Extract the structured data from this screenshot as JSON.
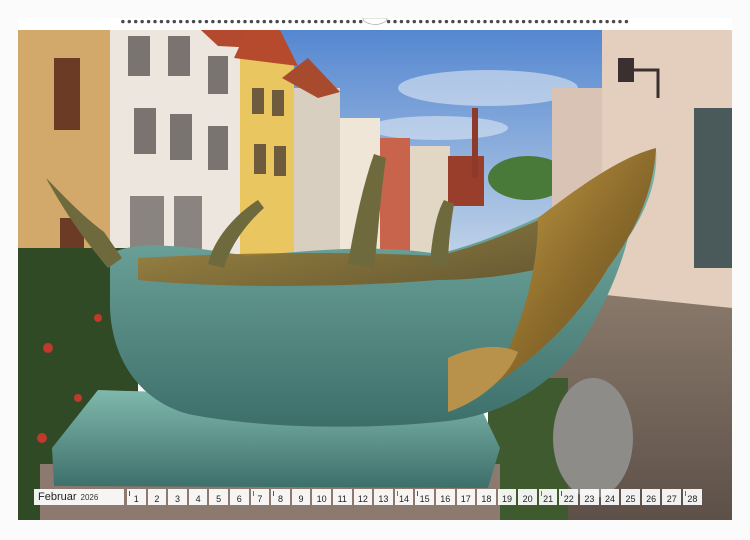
{
  "calendar": {
    "month": "Februar",
    "year": "2026",
    "days": [
      {
        "n": "1",
        "kind": "sun"
      },
      {
        "n": "2",
        "kind": "wd"
      },
      {
        "n": "3",
        "kind": "wd"
      },
      {
        "n": "4",
        "kind": "wd"
      },
      {
        "n": "5",
        "kind": "wd"
      },
      {
        "n": "6",
        "kind": "wd"
      },
      {
        "n": "7",
        "kind": "sat"
      },
      {
        "n": "8",
        "kind": "sun"
      },
      {
        "n": "9",
        "kind": "wd"
      },
      {
        "n": "10",
        "kind": "wd"
      },
      {
        "n": "11",
        "kind": "wd"
      },
      {
        "n": "12",
        "kind": "wd"
      },
      {
        "n": "13",
        "kind": "wd"
      },
      {
        "n": "14",
        "kind": "sat"
      },
      {
        "n": "15",
        "kind": "sun"
      },
      {
        "n": "16",
        "kind": "wd"
      },
      {
        "n": "17",
        "kind": "wd"
      },
      {
        "n": "18",
        "kind": "wd"
      },
      {
        "n": "19",
        "kind": "wd"
      },
      {
        "n": "20",
        "kind": "wd"
      },
      {
        "n": "21",
        "kind": "sat"
      },
      {
        "n": "22",
        "kind": "sun"
      },
      {
        "n": "23",
        "kind": "wd"
      },
      {
        "n": "24",
        "kind": "wd"
      },
      {
        "n": "25",
        "kind": "wd"
      },
      {
        "n": "26",
        "kind": "wd"
      },
      {
        "n": "27",
        "kind": "wd"
      },
      {
        "n": "28",
        "kind": "sat"
      }
    ]
  },
  "colors": {
    "sky": "#5f8fd4",
    "bronze": "#a88436",
    "patina": "#5f9a92",
    "saturday": "#2a9d3c",
    "sunday": "#c0262b"
  },
  "icons": [
    "spiral-binding-icon",
    "hanger-notch-icon"
  ]
}
